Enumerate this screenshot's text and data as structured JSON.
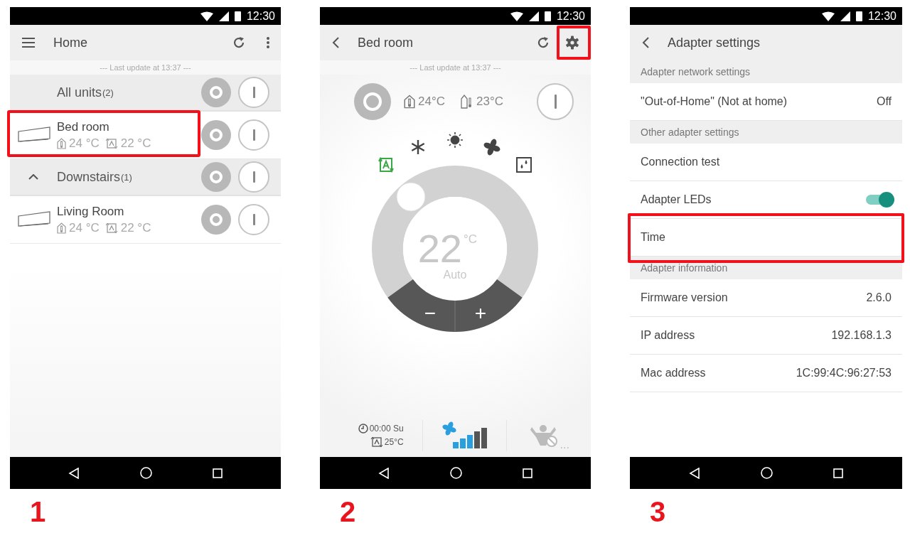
{
  "home_screen": {
    "step": "1",
    "status_time": "12:30",
    "title": "Home",
    "last_update": "--- Last update at 13:37 ---",
    "rows": [
      {
        "kind": "header",
        "label": "All units",
        "count": "(2)",
        "highlighted": false
      },
      {
        "kind": "unit",
        "name": "Bed room",
        "indoor": "24 °C",
        "setpoint": "22 °C",
        "highlighted": true
      },
      {
        "kind": "group",
        "label": "Downstairs",
        "count": "(1)",
        "expanded": true,
        "highlighted": false
      },
      {
        "kind": "unit",
        "name": "Living Room",
        "indoor": "24 °C",
        "setpoint": "22 °C",
        "highlighted": false
      }
    ]
  },
  "unit_screen": {
    "step": "2",
    "status_time": "12:30",
    "title": "Bed room",
    "settings_highlighted": true,
    "last_update": "--- Last update at 13:37 ---",
    "indoor": "24°C",
    "outdoor": "23°C",
    "modes": [
      {
        "kind": "auto",
        "selected": true
      },
      {
        "kind": "cool",
        "selected": false
      },
      {
        "kind": "heat",
        "selected": false
      },
      {
        "kind": "fan",
        "selected": false
      },
      {
        "kind": "dry",
        "selected": false
      }
    ],
    "temperature": "22",
    "unit": "°C",
    "mode_label": "Auto",
    "minus": "−",
    "plus": "+",
    "timer": "00:00 Su",
    "timer_setpoint": "25°C",
    "fan_speed": {
      "level": 0.6
    },
    "powerful_more": "..."
  },
  "settings_screen": {
    "step": "3",
    "status_time": "12:30",
    "title": "Adapter settings",
    "sections": [
      {
        "header": "Adapter network settings",
        "rows": [
          {
            "kind": "value",
            "label": "\"Out-of-Home\" (Not at home)",
            "value": "Off",
            "highlighted": false
          }
        ]
      },
      {
        "header": "Other adapter settings",
        "rows": [
          {
            "kind": "plain",
            "label": "Connection test",
            "highlighted": false
          },
          {
            "kind": "toggle",
            "label": "Adapter LEDs",
            "on": true,
            "highlighted": false
          },
          {
            "kind": "plain",
            "label": "Time",
            "highlighted": true
          }
        ]
      },
      {
        "header": "Adapter information",
        "rows": [
          {
            "kind": "value",
            "label": "Firmware version",
            "value": "2.6.0",
            "highlighted": false
          },
          {
            "kind": "value",
            "label": "IP address",
            "value": "192.168.1.3",
            "highlighted": false
          },
          {
            "kind": "value",
            "label": "Mac address",
            "value": "1C:99:4C:96:27:53",
            "highlighted": false
          }
        ]
      }
    ]
  }
}
